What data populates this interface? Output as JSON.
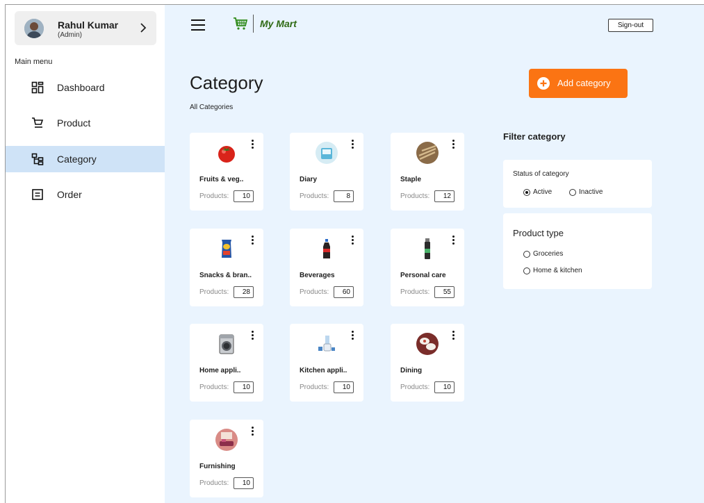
{
  "user": {
    "name": "Rahul Kumar",
    "role": "(Admin)"
  },
  "sidebar": {
    "menu_title": "Main menu",
    "items": [
      {
        "label": "Dashboard",
        "icon": "dashboard-icon",
        "active": false
      },
      {
        "label": "Product",
        "icon": "cart-icon",
        "active": false
      },
      {
        "label": "Category",
        "icon": "category-tree-icon",
        "active": true
      },
      {
        "label": "Order",
        "icon": "order-list-icon",
        "active": false
      }
    ]
  },
  "header": {
    "brand": "My Mart",
    "signout_label": "Sign-out"
  },
  "page": {
    "title": "Category",
    "subtitle": "All Categories",
    "add_label": "Add category"
  },
  "products_label": "Products:",
  "categories": [
    {
      "name": "Fruits & veg..",
      "count": "10",
      "thumb": "tomato"
    },
    {
      "name": "Diary",
      "count": "8",
      "thumb": "milk"
    },
    {
      "name": "Staple",
      "count": "12",
      "thumb": "grain"
    },
    {
      "name": "Snacks & bran..",
      "count": "28",
      "thumb": "chips"
    },
    {
      "name": "Beverages",
      "count": "60",
      "thumb": "bottle"
    },
    {
      "name": "Personal care",
      "count": "55",
      "thumb": "spray"
    },
    {
      "name": "Home appli..",
      "count": "10",
      "thumb": "washer"
    },
    {
      "name": "Kitchen appli..",
      "count": "10",
      "thumb": "mixer"
    },
    {
      "name": "Dining",
      "count": "10",
      "thumb": "plates"
    },
    {
      "name": "Furnishing",
      "count": "10",
      "thumb": "room"
    }
  ],
  "filter": {
    "title": "Filter category",
    "status": {
      "title": "Status of category",
      "options": [
        "Active",
        "Inactive"
      ],
      "selected": "Active"
    },
    "product_type": {
      "title": "Product type",
      "options": [
        "Groceries",
        "Home & kitchen"
      ],
      "selected": ""
    }
  },
  "colors": {
    "accent": "#fb7413",
    "brand": "#2f6a15",
    "active_nav": "#cfe3f7",
    "main_bg": "#eaf4fe"
  }
}
